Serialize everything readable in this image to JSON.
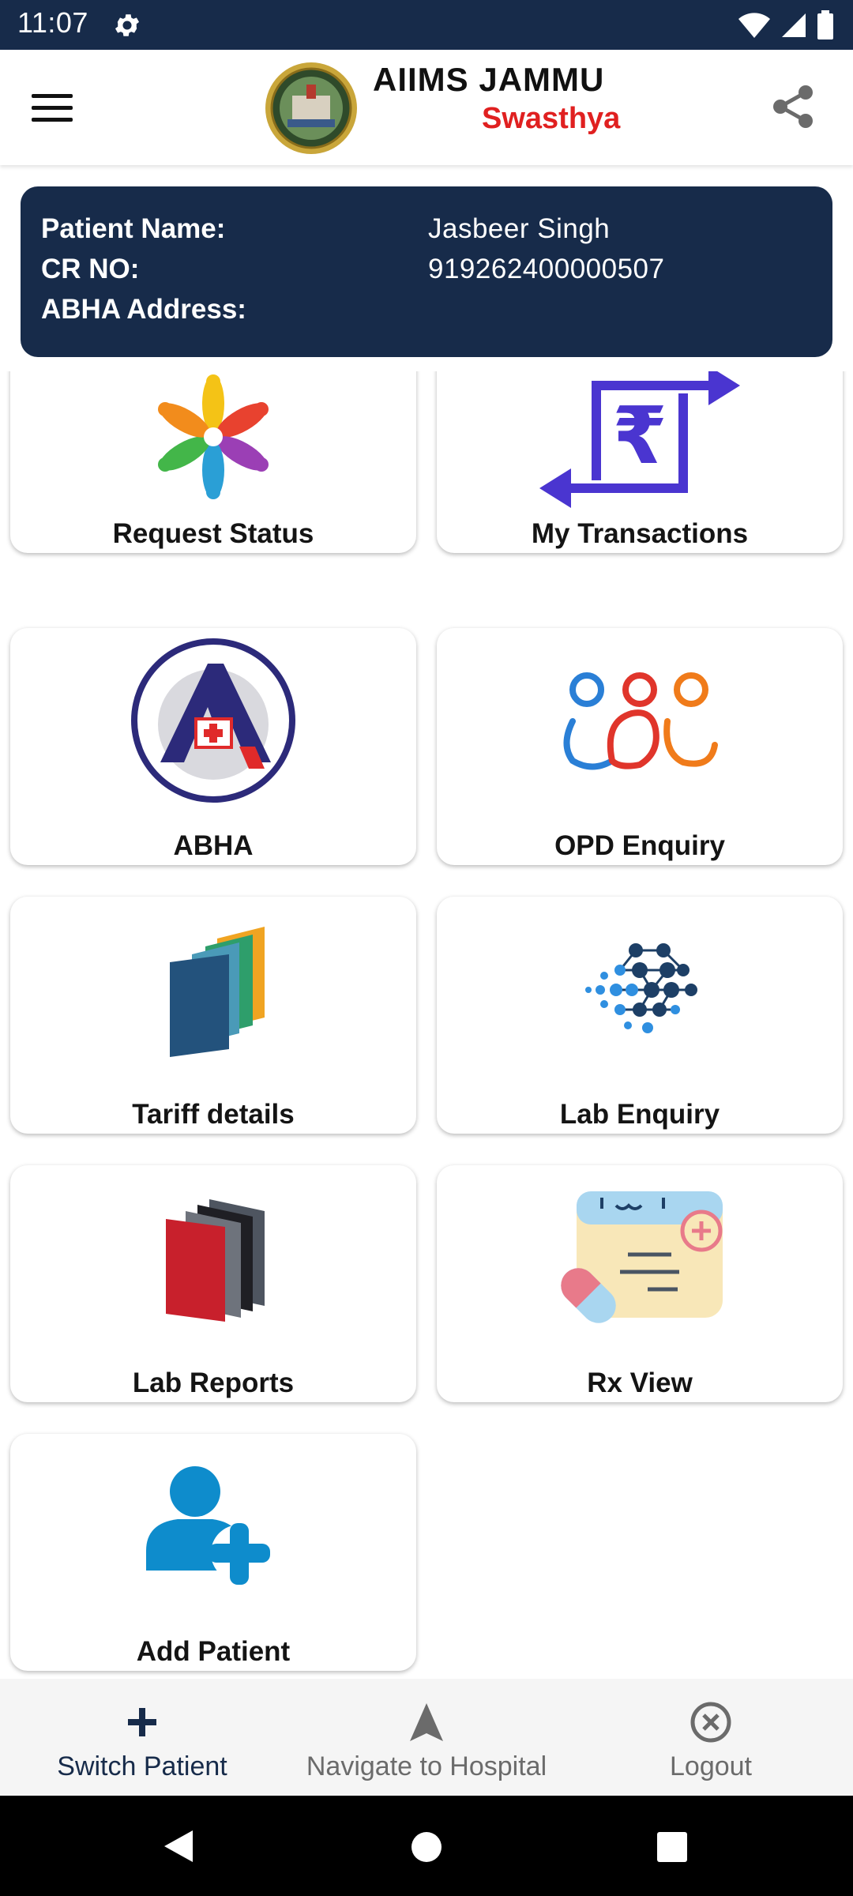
{
  "status_bar": {
    "time": "11:07"
  },
  "app_bar": {
    "brand_title": "AIIMS JAMMU",
    "brand_subtitle": "Swasthya"
  },
  "patient": {
    "name_label": "Patient Name:",
    "name_value": "Jasbeer Singh",
    "cr_label": "CR NO:",
    "cr_value": "919262400000507",
    "abha_label": "ABHA Address:",
    "abha_value": ""
  },
  "tiles": [
    {
      "label": "Request Status",
      "icon": "request-status-icon"
    },
    {
      "label": "My Transactions",
      "icon": "rupee-transfer-icon"
    },
    {
      "label": "ABHA",
      "icon": "abha-logo-icon"
    },
    {
      "label": "OPD Enquiry",
      "icon": "opd-people-icon"
    },
    {
      "label": "Tariff details",
      "icon": "tariff-folders-icon"
    },
    {
      "label": "Lab Enquiry",
      "icon": "lab-network-icon"
    },
    {
      "label": "Lab Reports",
      "icon": "lab-reports-folders-icon"
    },
    {
      "label": "Rx View",
      "icon": "prescription-icon"
    },
    {
      "label": "Add Patient",
      "icon": "add-patient-icon"
    }
  ],
  "bottom_nav": {
    "switch_patient": "Switch Patient",
    "navigate": "Navigate to Hospital",
    "logout": "Logout"
  },
  "colors": {
    "primary_dark": "#172b4a",
    "brand_red": "#e02020",
    "accent_blue": "#1f3fa0"
  }
}
